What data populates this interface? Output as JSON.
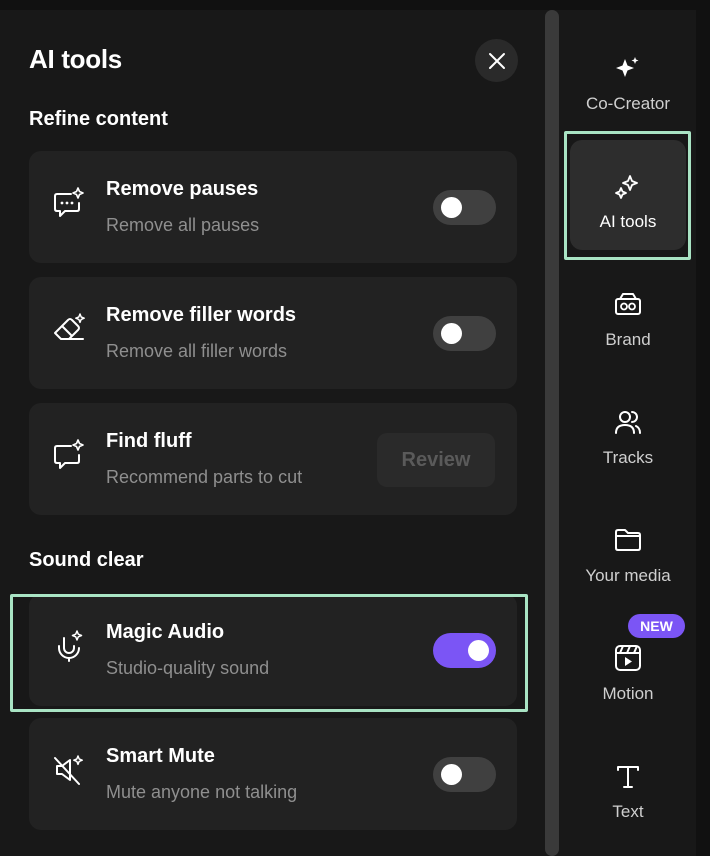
{
  "panel": {
    "title": "AI tools"
  },
  "sections": {
    "refine": "Refine content",
    "sound": "Sound clear"
  },
  "cards": {
    "remove_pauses": {
      "name": "Remove pauses",
      "desc": "Remove all pauses",
      "enabled": false
    },
    "remove_filler": {
      "name": "Remove filler words",
      "desc": "Remove all filler words",
      "enabled": false
    },
    "find_fluff": {
      "name": "Find fluff",
      "desc": "Recommend parts to cut",
      "button": "Review"
    },
    "magic_audio": {
      "name": "Magic Audio",
      "desc": "Studio-quality sound",
      "enabled": true
    },
    "smart_mute": {
      "name": "Smart Mute",
      "desc": "Mute anyone not talking",
      "enabled": false
    }
  },
  "sidebar": {
    "items": [
      {
        "label": "Co-Creator",
        "icon": "sparkle-icon"
      },
      {
        "label": "AI tools",
        "icon": "ai-sparkles-icon",
        "active": true
      },
      {
        "label": "Brand",
        "icon": "brand-icon"
      },
      {
        "label": "Tracks",
        "icon": "tracks-icon"
      },
      {
        "label": "Your media",
        "icon": "folder-icon"
      },
      {
        "label": "Motion",
        "icon": "motion-icon",
        "badge": "NEW"
      },
      {
        "label": "Text",
        "icon": "text-icon"
      }
    ]
  },
  "colors": {
    "accent": "#7b55f5",
    "highlight": "#a9e4c4",
    "background": "#181818",
    "card": "#222222"
  }
}
